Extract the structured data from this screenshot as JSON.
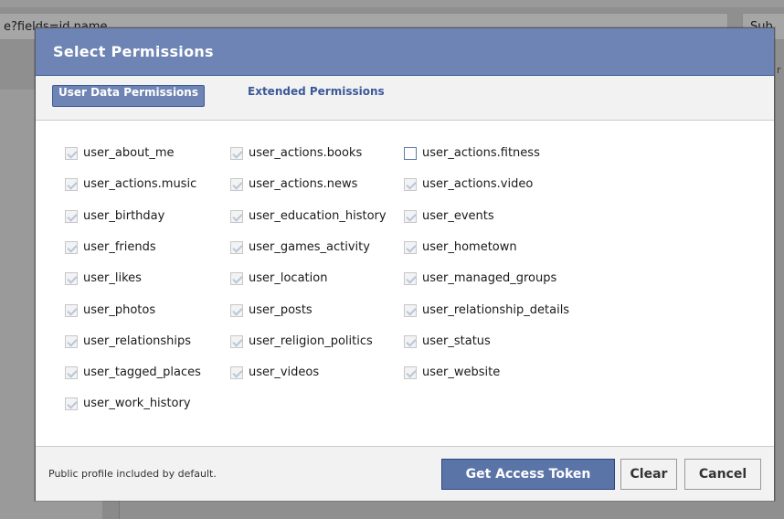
{
  "background": {
    "url_text": "e?fields=id,name",
    "button_text": "Sub",
    "sliver_text": "r"
  },
  "dialog": {
    "title": "Select Permissions",
    "tabs": [
      {
        "label": "User Data Permissions",
        "active": true
      },
      {
        "label": "Extended Permissions",
        "active": false
      }
    ],
    "permissions": {
      "col1": [
        {
          "label": "user_about_me",
          "checked": true
        },
        {
          "label": "user_actions.music",
          "checked": true
        },
        {
          "label": "user_birthday",
          "checked": true
        },
        {
          "label": "user_friends",
          "checked": true
        },
        {
          "label": "user_likes",
          "checked": true
        },
        {
          "label": "user_photos",
          "checked": true
        },
        {
          "label": "user_relationships",
          "checked": true
        },
        {
          "label": "user_tagged_places",
          "checked": true
        },
        {
          "label": "user_work_history",
          "checked": true
        }
      ],
      "col2": [
        {
          "label": "user_actions.books",
          "checked": true
        },
        {
          "label": "user_actions.news",
          "checked": true
        },
        {
          "label": "user_education_history",
          "checked": true
        },
        {
          "label": "user_games_activity",
          "checked": true
        },
        {
          "label": "user_location",
          "checked": true
        },
        {
          "label": "user_posts",
          "checked": true
        },
        {
          "label": "user_religion_politics",
          "checked": true
        },
        {
          "label": "user_videos",
          "checked": true
        }
      ],
      "col3": [
        {
          "label": "user_actions.fitness",
          "checked": false
        },
        {
          "label": "user_actions.video",
          "checked": true
        },
        {
          "label": "user_events",
          "checked": true
        },
        {
          "label": "user_hometown",
          "checked": true
        },
        {
          "label": "user_managed_groups",
          "checked": true
        },
        {
          "label": "user_relationship_details",
          "checked": true
        },
        {
          "label": "user_status",
          "checked": true
        },
        {
          "label": "user_website",
          "checked": true
        }
      ]
    },
    "footer": {
      "note": "Public profile included by default.",
      "get_token_label": "Get Access Token",
      "clear_label": "Clear",
      "cancel_label": "Cancel"
    }
  },
  "colors": {
    "header": "#6d84b4",
    "primary_button": "#5b74a8",
    "link": "#3b5998"
  }
}
